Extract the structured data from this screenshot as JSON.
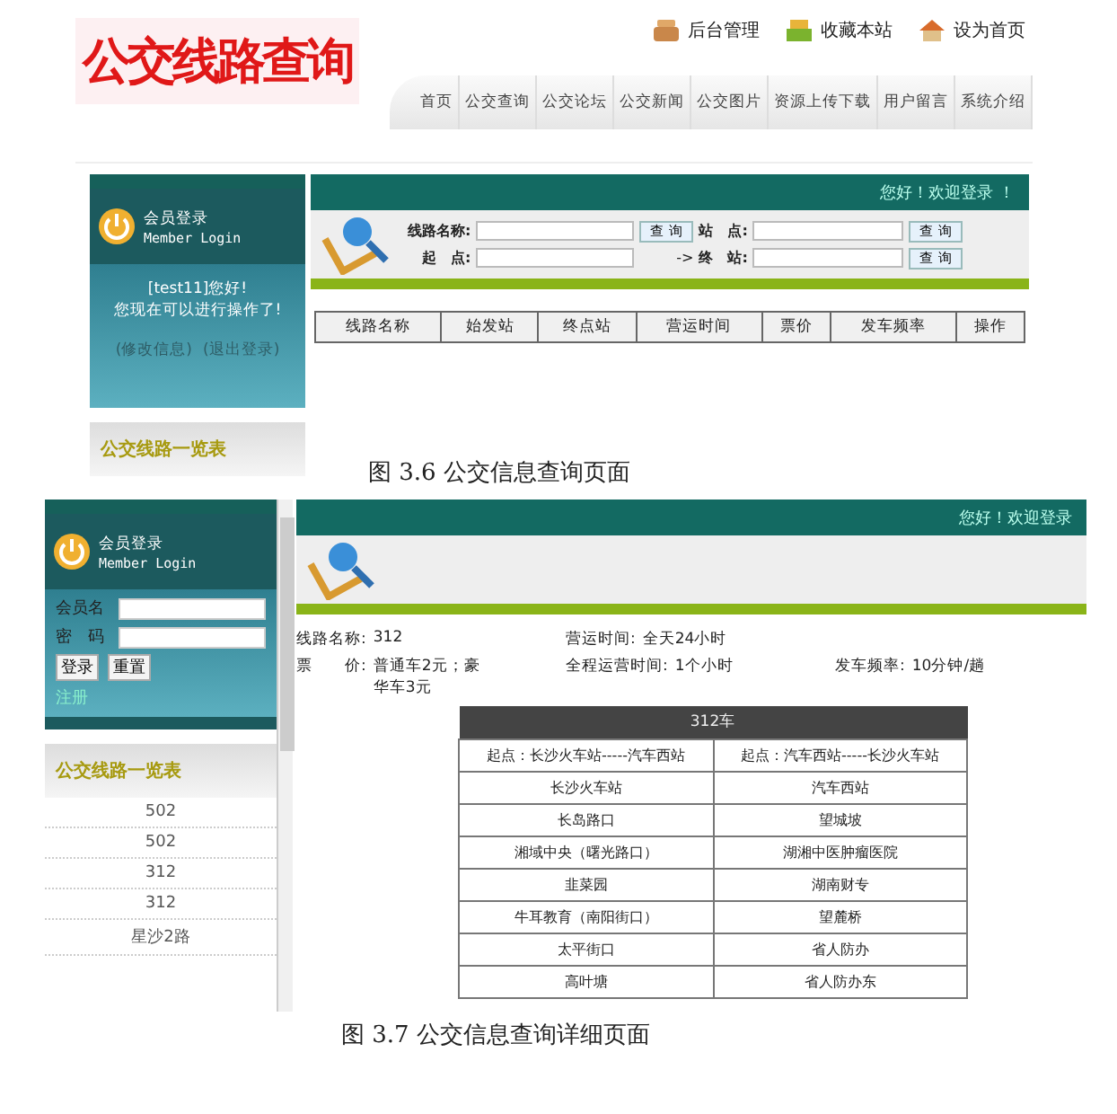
{
  "figure_1": {
    "site_title": "公交线路查询",
    "top_links": [
      {
        "label": "后台管理",
        "kind": "admin"
      },
      {
        "label": "收藏本站",
        "kind": "favorite"
      },
      {
        "label": "设为首页",
        "kind": "home"
      }
    ],
    "nav": [
      "首页",
      "公交查询",
      "公交论坛",
      "公交新闻",
      "公交图片",
      "资源上传下载",
      "用户留言",
      "系统介绍"
    ],
    "login": {
      "title": "会员登录",
      "subtitle": "Member Login",
      "greeting": "[test11]您好!",
      "message": "您现在可以进行操作了!",
      "links": [
        "(修改信息)",
        "(退出登录)"
      ]
    },
    "list_heading": "公交线路一览表",
    "welcome": "您好！欢迎登录 ！",
    "search": {
      "route_label": "线路名称:",
      "station_label": "站　点:",
      "start_label": "起　点:",
      "arrow": "->",
      "end_label": "终　站:",
      "buttons": [
        "查 询",
        "查 询",
        "查 询"
      ]
    },
    "table": {
      "columns": [
        "线路名称",
        "始发站",
        "终点站",
        "营运时间",
        "票价",
        "发车频率",
        "操作"
      ]
    }
  },
  "caption_1": "图 3.6 公交信息查询页面",
  "figure_2": {
    "login": {
      "title": "会员登录",
      "subtitle": "Member Login",
      "username_label": "会员名",
      "password_label": "密　码",
      "buttons": [
        "登录",
        "重置"
      ],
      "register": "注册"
    },
    "list_heading": "公交线路一览表",
    "routes": [
      "502",
      "502",
      "312",
      "312",
      "星沙2路"
    ],
    "welcome": "您好！欢迎登录",
    "details": [
      {
        "label": "线路名称:",
        "value": "312"
      },
      {
        "label": "营运时间:",
        "value": "全天24小时"
      },
      {
        "label": "票　　价:",
        "value": "普通车2元；豪华车3元"
      },
      {
        "label": "全程运营时间:",
        "value": "1个小时"
      },
      {
        "label": "发车频率:",
        "value": "10分钟/趟"
      }
    ],
    "stops": {
      "title": "312车",
      "directions": [
        "起点：长沙火车站-----汽车西站",
        "起点：汽车西站-----长沙火车站"
      ],
      "rows": [
        [
          "长沙火车站",
          "汽车西站"
        ],
        [
          "长岛路口",
          "望城坡"
        ],
        [
          "湘域中央（曙光路口）",
          "湖湘中医肿瘤医院"
        ],
        [
          "韭菜园",
          "湖南财专"
        ],
        [
          "牛耳教育（南阳街口）",
          "望麓桥"
        ],
        [
          "太平街口",
          "省人防办"
        ],
        [
          "高叶塘",
          "省人防办东"
        ]
      ]
    }
  },
  "caption_2": "图 3.7 公交信息查询详细页面"
}
